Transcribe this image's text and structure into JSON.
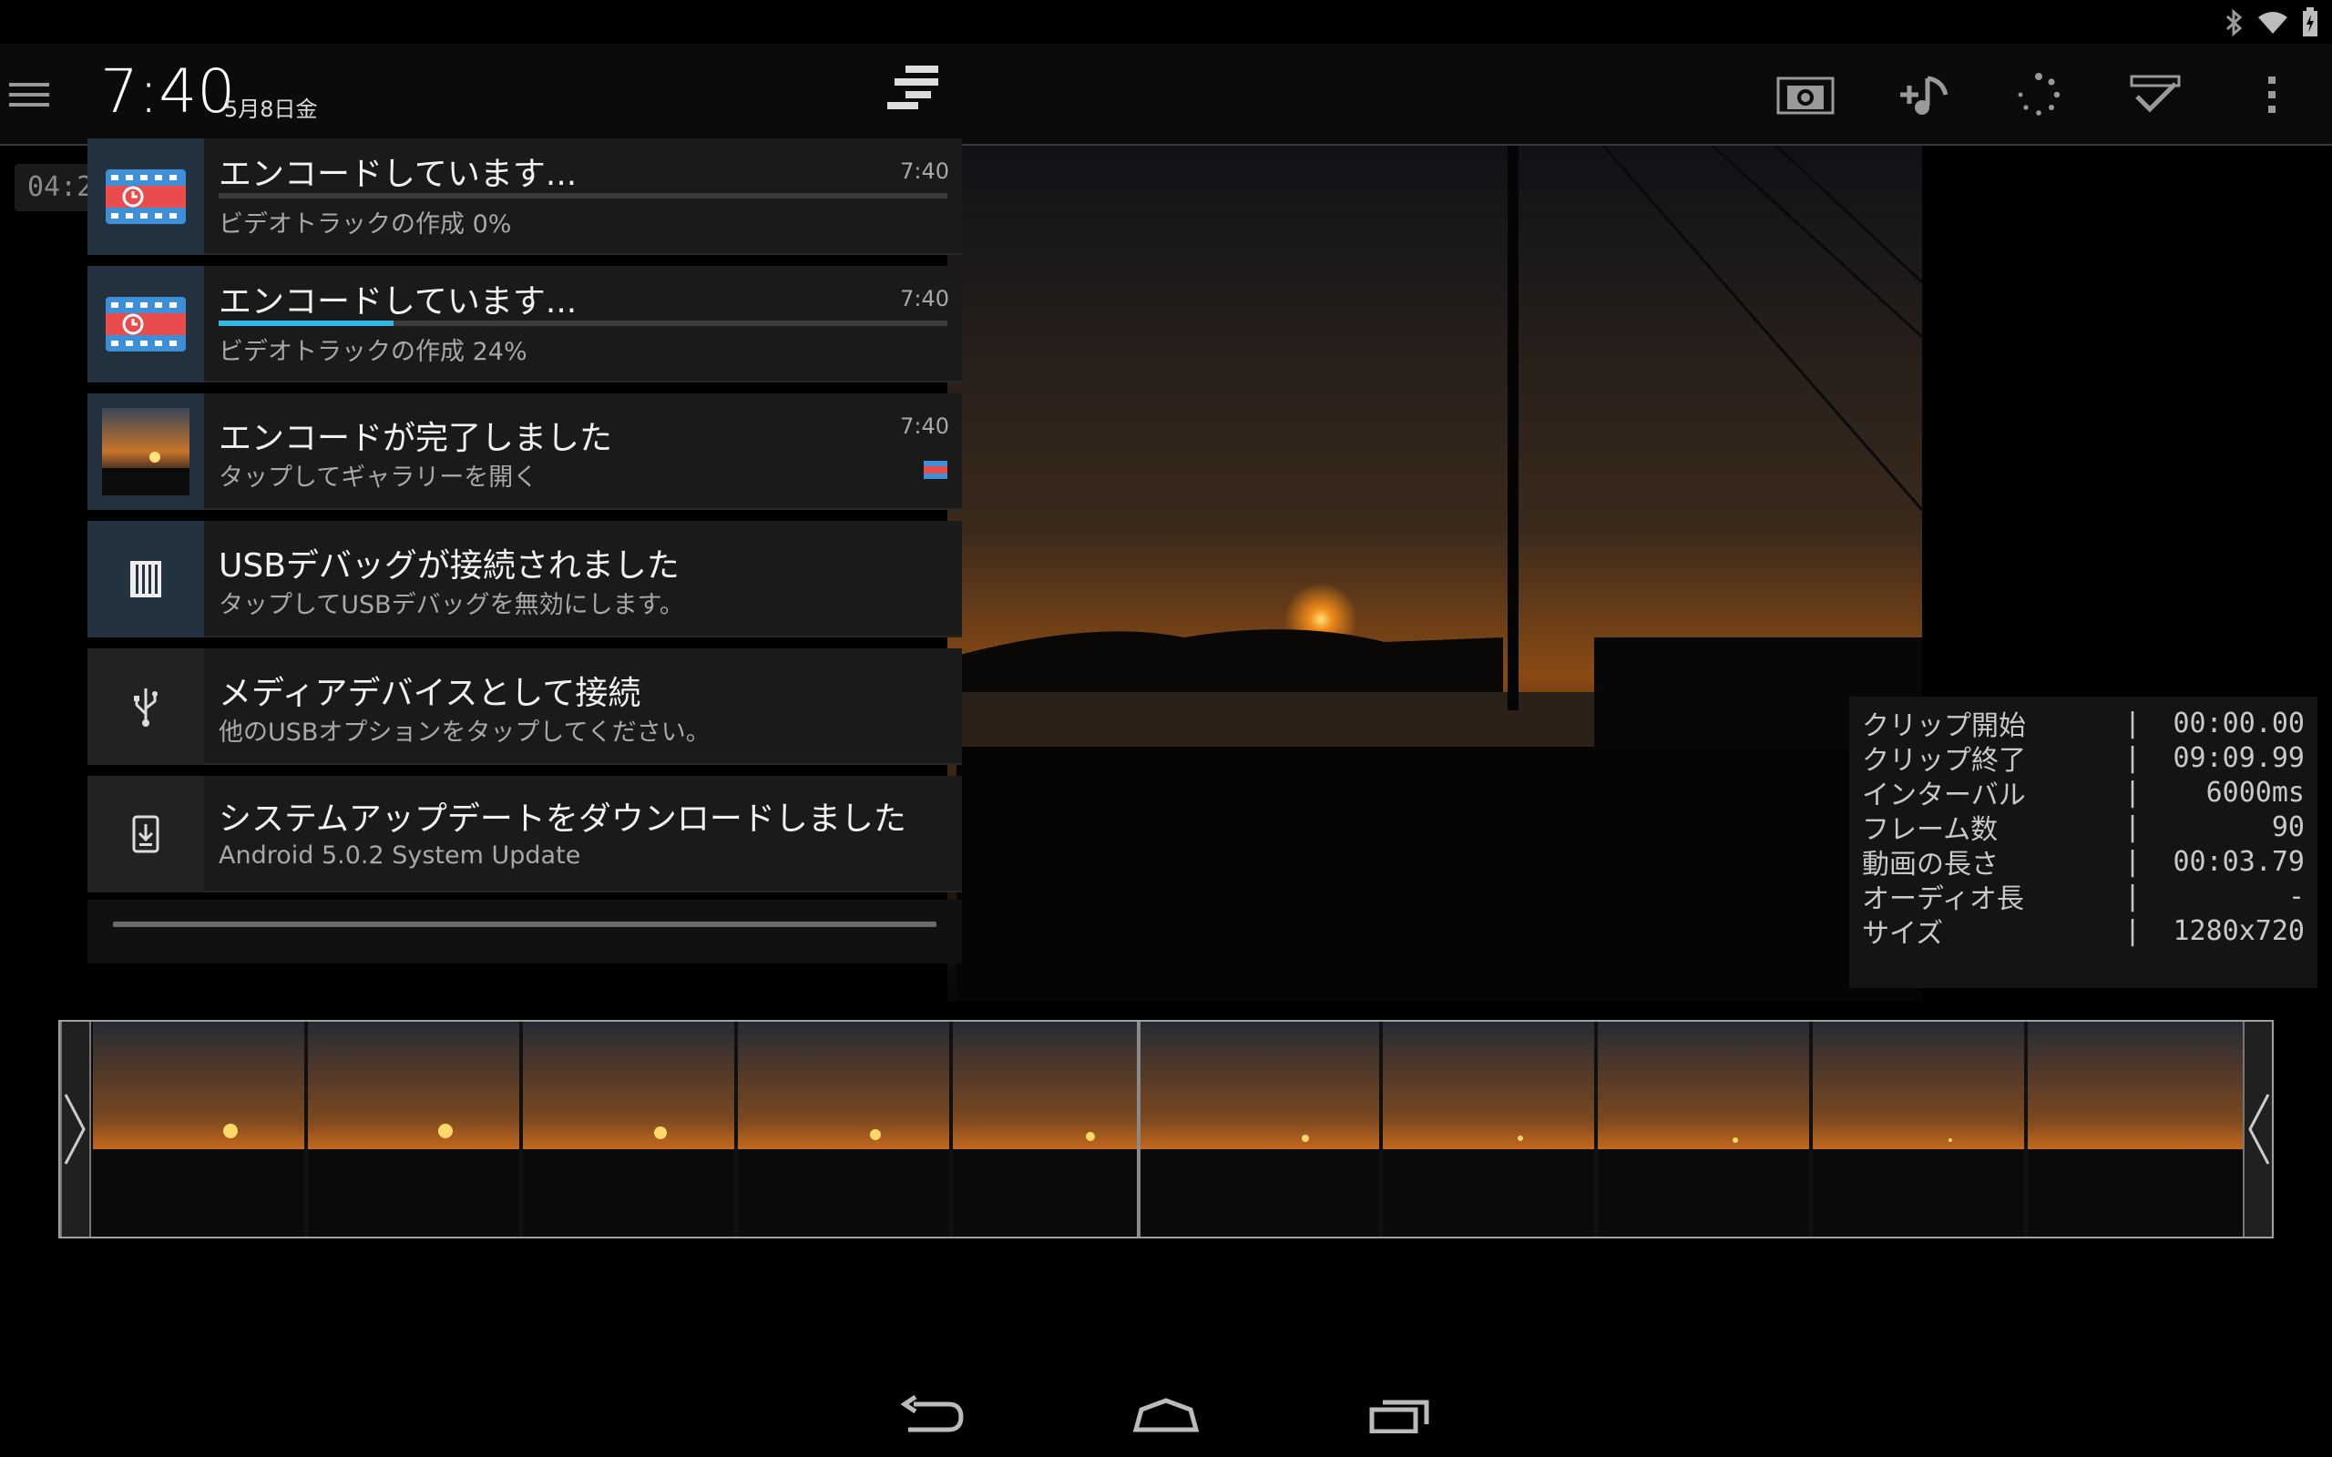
{
  "status_bar": {
    "icons": [
      "bluetooth-icon",
      "wifi-icon",
      "battery-charging-icon"
    ]
  },
  "action_bar": {
    "icons": [
      "menu-icon",
      "snapshot-icon",
      "add-audio-icon",
      "loading-spinner-icon",
      "trim-apply-icon",
      "overflow-menu-icon"
    ]
  },
  "video": {
    "time_label": "04:2"
  },
  "shade": {
    "clock": "7:40",
    "date": "5月8日金",
    "notifications": [
      {
        "title": "エンコードしています...",
        "text": "ビデオトラックの作成 0%",
        "time": "7:40",
        "progress": 0,
        "icon": "encoder-app-icon"
      },
      {
        "title": "エンコードしています...",
        "text": "ビデオトラックの作成 24%",
        "time": "7:40",
        "progress": 24,
        "icon": "encoder-app-icon"
      },
      {
        "title": "エンコードが完了しました",
        "text": "タップしてギャラリーを開く",
        "time": "7:40",
        "icon": "sunset-thumbnail"
      },
      {
        "title": "USBデバッグが接続されました",
        "text": "タップしてUSBデバッグを無効にします。",
        "icon": "usb-debug-icon"
      },
      {
        "title": "メディアデバイスとして接続",
        "text": "他のUSBオプションをタップしてください。",
        "icon": "usb-icon"
      },
      {
        "title": "システムアップデートをダウンロードしました",
        "text": "Android 5.0.2 System Update",
        "icon": "system-update-icon"
      }
    ]
  },
  "info_panel": {
    "rows": [
      {
        "label": "クリップ開始",
        "value": "00:00.00"
      },
      {
        "label": "クリップ終了",
        "value": "09:09.99"
      },
      {
        "label": "インターバル",
        "value": "6000ms"
      },
      {
        "label": "フレーム数",
        "value": "90"
      },
      {
        "label": "動画の長さ",
        "value": "00:03.79"
      },
      {
        "label": "オーディオ長",
        "value": "-"
      },
      {
        "label": "サイズ",
        "value": "1280x720"
      }
    ]
  },
  "filmstrip": {
    "frame_count": 10
  },
  "nav_bar": {
    "buttons": [
      "back-icon",
      "home-icon",
      "recents-icon"
    ]
  }
}
